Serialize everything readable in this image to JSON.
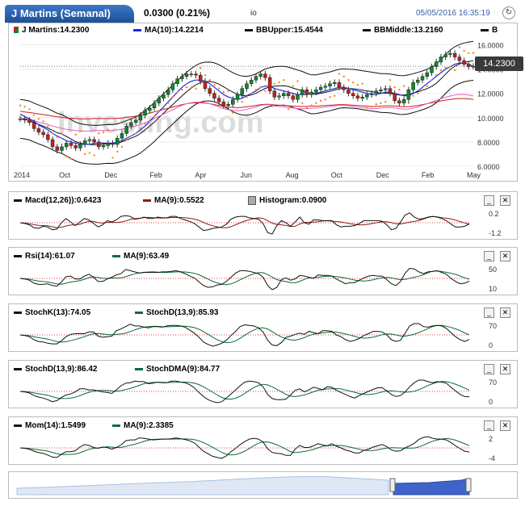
{
  "header": {
    "title": "J Martins (Semanal)",
    "price_change": "0.0300 (0.21%)",
    "io_label": "io",
    "datetime": "05/05/2016 16:35:19",
    "refresh_icon": "refresh-icon"
  },
  "main": {
    "legend": {
      "price": "J Martins:14.2300",
      "ma": "MA(10):14.2214",
      "bbupper": "BBUpper:15.4544",
      "bbmiddle": "BBMiddle:13.2160",
      "b": "B"
    },
    "last_price": "14.2300",
    "watermark": "Investing.com",
    "colors": {
      "ma": "#1b2be6",
      "bbupper": "#111111",
      "bbmiddle": "#111111",
      "sar": "#f08a1c",
      "ma_long_red": "#d01c1c",
      "ma_pink": "#e35fc8",
      "up": "#0a8a2a",
      "down": "#c81e1e"
    }
  },
  "panels": {
    "macd": {
      "legend1": "Macd(12,26)):0.6423",
      "legend2": "MA(9):0.5522",
      "legend3": "Histogram:0.0900",
      "ticks": [
        "0.2",
        "-1.2"
      ]
    },
    "rsi": {
      "legend1": "Rsi(14):61.07",
      "legend2": "MA(9):63.49",
      "ticks": [
        "50",
        "10"
      ]
    },
    "stoch": {
      "legend1": "StochK(13):74.05",
      "legend2": "StochD(13,9):85.93",
      "ticks": [
        "70",
        "0"
      ]
    },
    "stochd": {
      "legend1": "StochD(13,9):86.42",
      "legend2": "StochDMA(9):84.77",
      "ticks": [
        "70",
        "0"
      ]
    },
    "mom": {
      "legend1": "Mom(14):1.5499",
      "legend2": "MA(9):2.3385",
      "ticks": [
        "2",
        "-4"
      ]
    }
  },
  "buttons": {
    "minimize": "_",
    "close": "✕"
  },
  "chart_data": {
    "type": "candlestick",
    "title": "J Martins (Semanal)",
    "x_ticks": [
      "2014",
      "Oct",
      "Dec",
      "Feb",
      "Apr",
      "Jun",
      "Aug",
      "Oct",
      "Dec",
      "Feb",
      "May"
    ],
    "y_ticks": [
      "16.0000",
      "14.0000",
      "12.0000",
      "10.0000",
      "8.0000",
      "6.0000"
    ],
    "ylim": [
      6,
      16.5
    ],
    "close": [
      9.9,
      9.8,
      9.6,
      9.1,
      8.8,
      8.6,
      8.2,
      7.6,
      7.3,
      7.6,
      7.9,
      7.7,
      7.5,
      7.8,
      8.1,
      8.2,
      8.0,
      7.6,
      7.7,
      7.9,
      7.8,
      8.3,
      8.7,
      9.3,
      9.6,
      9.8,
      10.2,
      10.6,
      10.8,
      11.2,
      11.6,
      11.9,
      12.3,
      12.8,
      13.2,
      13.4,
      13.6,
      13.6,
      13.5,
      13.0,
      12.4,
      12.0,
      11.6,
      11.3,
      11.0,
      11.1,
      11.5,
      11.9,
      12.4,
      12.8,
      13.1,
      13.4,
      13.6,
      13.3,
      12.2,
      11.7,
      11.8,
      12.0,
      11.8,
      11.5,
      11.9,
      12.3,
      11.9,
      12.1,
      12.3,
      12.5,
      12.6,
      12.8,
      12.9,
      12.5,
      12.3,
      12.0,
      11.8,
      11.6,
      11.7,
      11.9,
      12.0,
      12.2,
      12.3,
      12.4,
      12.0,
      11.4,
      11.2,
      11.5,
      12.3,
      12.9,
      13.1,
      13.4,
      13.7,
      14.2,
      14.6,
      15.0,
      15.2,
      15.3,
      15.0,
      14.7,
      14.4,
      14.2,
      14.23
    ],
    "ma10": [
      10.3,
      10.1,
      9.9,
      9.7,
      9.4,
      9.2,
      9.0,
      8.7,
      8.5,
      8.3,
      8.1,
      8.0,
      7.9,
      7.8,
      7.8,
      7.8,
      7.9,
      7.9,
      7.9,
      7.9,
      7.9,
      8.0,
      8.1,
      8.3,
      8.5,
      8.7,
      9.0,
      9.3,
      9.7,
      10.1,
      10.5,
      10.9,
      11.3,
      11.7,
      12.1,
      12.5,
      12.8,
      13.0,
      13.1,
      13.1,
      13.0,
      12.8,
      12.5,
      12.2,
      11.9,
      11.7,
      11.6,
      11.5,
      11.6,
      11.8,
      12.0,
      12.2,
      12.5,
      12.6,
      12.6,
      12.4,
      12.3,
      12.2,
      12.1,
      12.0,
      11.9,
      11.9,
      11.9,
      12.0,
      12.0,
      12.1,
      12.2,
      12.3,
      12.4,
      12.5,
      12.5,
      12.4,
      12.3,
      12.2,
      12.1,
      12.0,
      11.9,
      11.9,
      12.0,
      12.1,
      12.1,
      12.0,
      11.9,
      11.8,
      11.8,
      12.0,
      12.2,
      12.5,
      12.8,
      13.1,
      13.4,
      13.7,
      14.0,
      14.2,
      14.4,
      14.5,
      14.5,
      14.4,
      14.22
    ]
  }
}
